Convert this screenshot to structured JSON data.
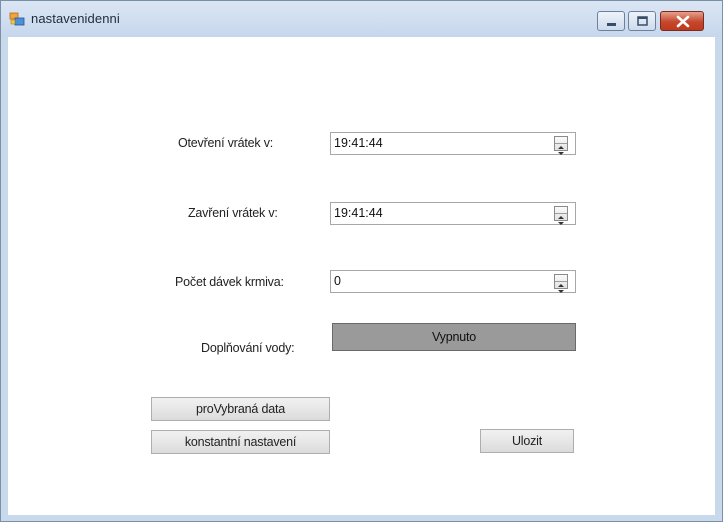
{
  "window": {
    "title": "nastavenidenni",
    "icons": {
      "app": "app-window-icon",
      "minimize": "minimize-icon",
      "maximize": "maximize-icon",
      "close": "close-icon"
    }
  },
  "form": {
    "open_time": {
      "label": "Otevření vrátek v:",
      "value": "19:41:44"
    },
    "close_time": {
      "label": "Zavření vrátek v:",
      "value": "19:41:44"
    },
    "feed_count": {
      "label": "Počet dávek krmiva:",
      "value": "0"
    },
    "water_refill": {
      "label": "Doplňování vody:",
      "state_label": "Vypnuto"
    }
  },
  "buttons": {
    "selected_data": "proVybraná data",
    "constant_settings": "konstantní nastavení",
    "save": "Ulozit"
  }
}
